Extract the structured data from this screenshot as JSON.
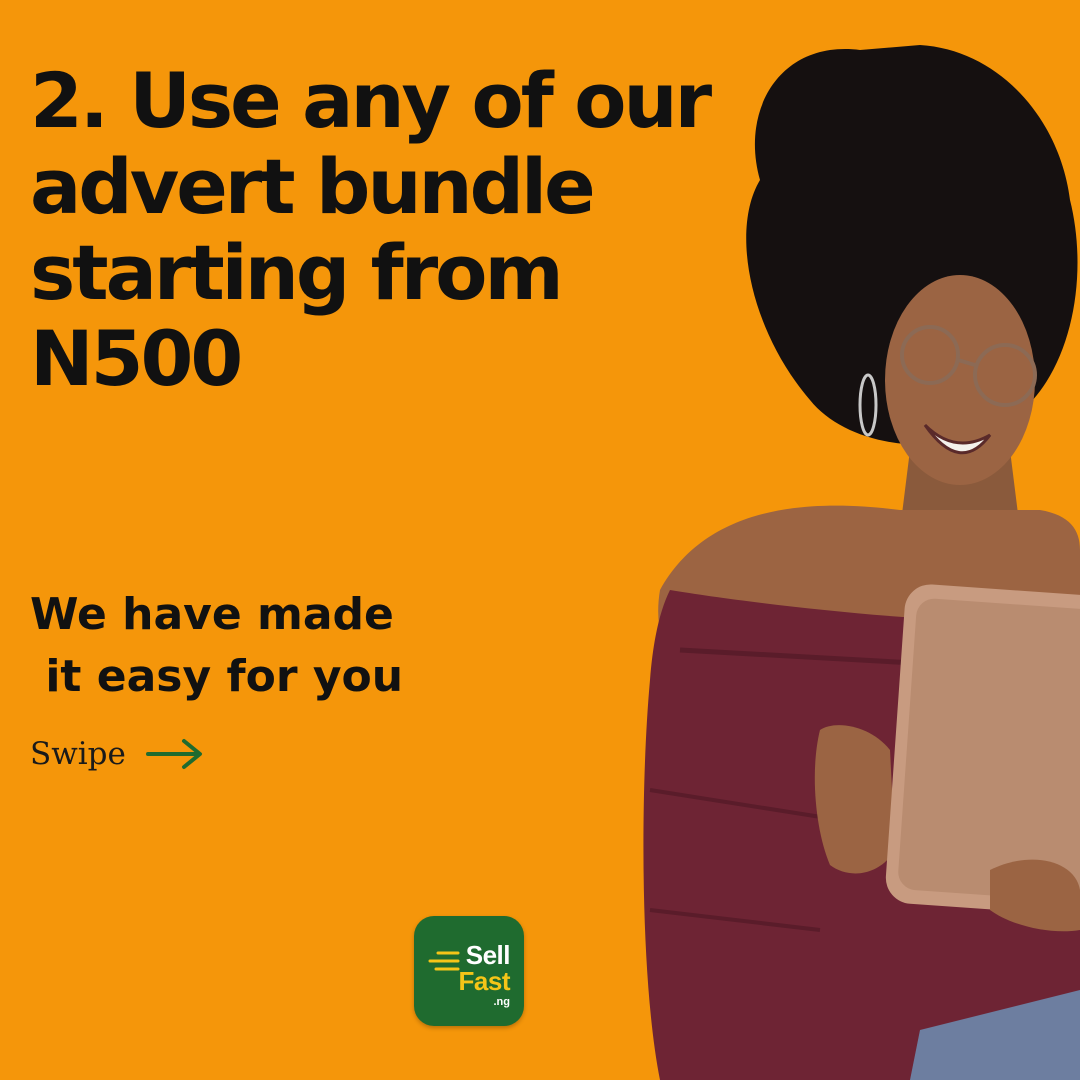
{
  "headline": {
    "lines": [
      "2. Use any of our",
      "advert bundle",
      "starting from",
      "N500"
    ]
  },
  "subhead": {
    "lines": [
      "We have made",
      " it easy for you"
    ]
  },
  "swipe": {
    "label": "Swipe",
    "icon": "arrow-right-icon"
  },
  "logo": {
    "line1": "Sell",
    "line2": "Fast",
    "suffix": ".ng"
  },
  "colors": {
    "background": "#f5960a",
    "text": "#111111",
    "arrow": "#1f6b2f",
    "logo_bg": "#1f6b2f",
    "logo_accent": "#f5c518"
  }
}
